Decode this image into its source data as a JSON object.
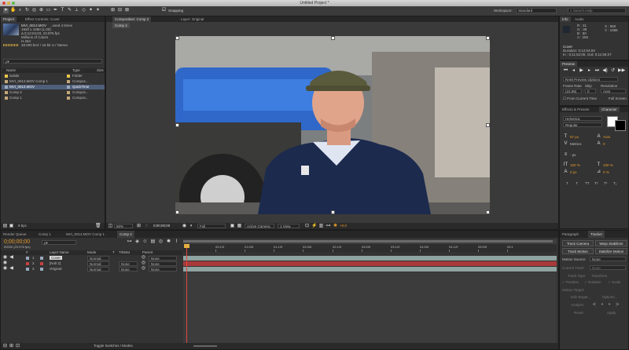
{
  "window": {
    "title": "Untitled Project *"
  },
  "toolbar": {
    "snapping_label": "Snapping",
    "workspace_label": "Workspace:",
    "workspace_value": "Standard",
    "search_placeholder": "Search Help"
  },
  "project": {
    "tab_project": "Project",
    "tab_effect_controls": "Effect Controls: Cover",
    "footage": {
      "name": "MVI_0013.MOV",
      "used": ", used 4 times",
      "res": "1920 x 1080 (1.00)",
      "dur": "Δ 0;12;04;03, 23.976 fps",
      "colors": "Millions of Colors",
      "codec": "H.264",
      "audio": "48.000 kHz / 16 bit U / Stereo"
    },
    "search_value": "ρ▾",
    "columns": {
      "name": "Name",
      "type": "Type",
      "size": "Size"
    },
    "items": [
      {
        "name": "Solids",
        "type": "Folder",
        "color": "#e8c64a"
      },
      {
        "name": "MVI_0013.MOV Comp 1",
        "type": "Compos...",
        "color": "#c3a87a"
      },
      {
        "name": "MVI_0013.MOV",
        "type": "QuickTime",
        "color": "#9aa9bf"
      },
      {
        "name": "Comp 2",
        "type": "Compos...",
        "color": "#c3a87a"
      },
      {
        "name": "Comp 1",
        "type": "Compos...",
        "color": "#c3a87a"
      }
    ],
    "bpc": "8 bpc"
  },
  "composition": {
    "tab_comp": "Composition: Comp 2",
    "tab_layer": "Layer: Original",
    "inner_tab": "Comp 2",
    "zoom": "50%",
    "timecode": "0;00;00;00",
    "resolution": "Full",
    "camera": "Active Camera",
    "view": "1 View",
    "exposure": "+0.0"
  },
  "info": {
    "tab_info": "Info",
    "tab_audio": "Audio",
    "r": "R : 31",
    "g": "G : 39",
    "b": "B : 50",
    "a": "A : 255",
    "x": "X : 660",
    "y": "Y : 1066",
    "layer": "Cover",
    "duration": "Duration: 0;12;04;03",
    "in_out": "In : 0;11;52;05, Out: 0;11;59;27"
  },
  "preview": {
    "tab": "Preview",
    "ram_options": "RAM Preview Options",
    "frame_rate_label": "Frame Rate",
    "skip_label": "Skip",
    "resolution_label": "Resolution",
    "frame_rate": "(23.98)",
    "skip": "0",
    "resolution": "Auto",
    "from_current": "From Current Time",
    "full_screen": "Full Screen"
  },
  "character": {
    "tab_effects": "Effects & Presets",
    "tab_character": "Character",
    "font": "Helvetica",
    "style": "Regular",
    "size": "57 px",
    "leading": "Auto",
    "kerning": "Metrics",
    "tracking": "0",
    "stroke": "- px",
    "vscale": "100 %",
    "hscale": "100 %",
    "baseline": "0 px",
    "tsume": "0 %",
    "styles": [
      "T",
      "T",
      "TT",
      "Tт",
      "T¹",
      "T₁"
    ]
  },
  "tracker": {
    "tab_paragraph": "Paragraph",
    "tab_tracker": "Tracker",
    "track_camera": "Track Camera",
    "warp_stabilizer": "Warp Stabilizer",
    "track_motion": "Track Motion",
    "stabilize_motion": "Stabilize Motion",
    "motion_source_label": "Motion Source:",
    "motion_source": "None",
    "current_track_label": "Current Track:",
    "current_track": "None",
    "track_type_label": "Track Type:",
    "track_type": "Transform",
    "position": "✓ Position",
    "rotation": "✓ Rotation",
    "scale": "✓ Scale",
    "motion_target": "Motion Target:",
    "edit_target": "Edit Target...",
    "options": "Options...",
    "analyze_label": "Analyze:",
    "reset": "Reset",
    "apply": "Apply"
  },
  "timeline": {
    "tabs": [
      "Render Queue",
      "Comp 1",
      "MVI_0013.MOV Comp 1",
      "Comp 2"
    ],
    "timecode": "0;00;00;00",
    "fps": "00000 (23.976 fps)",
    "search_value": "ρ▾",
    "cols": {
      "num": "#",
      "layer": "Layer Name",
      "mode": "Mode",
      "t": "T",
      "trkmat": "TrkMat",
      "parent": "Parent"
    },
    "layers": [
      {
        "num": "1",
        "name": "Cover",
        "mode": "Normal",
        "trkmat": "",
        "parent": "None",
        "color": "#9aa9bf",
        "bar": "#8fa3a0"
      },
      {
        "num": "2",
        "name": "[Null 2]",
        "mode": "Normal",
        "trkmat": "None",
        "parent": "None",
        "color": "#c84040",
        "bar": "#a83a3a"
      },
      {
        "num": "3",
        "name": "Original",
        "mode": "Normal",
        "trkmat": "None",
        "parent": "None",
        "color": "#9aa9bf",
        "bar": "#8fa3a0"
      }
    ],
    "ruler": [
      "0f",
      "00:12f",
      "01:00f",
      "01:12f",
      "02:00f",
      "02:12f",
      "03:00f",
      "03:12f",
      "04:00f",
      "04:12f",
      "05:00f",
      "05:1"
    ],
    "toggle_label": "Toggle Switches / Modes"
  }
}
